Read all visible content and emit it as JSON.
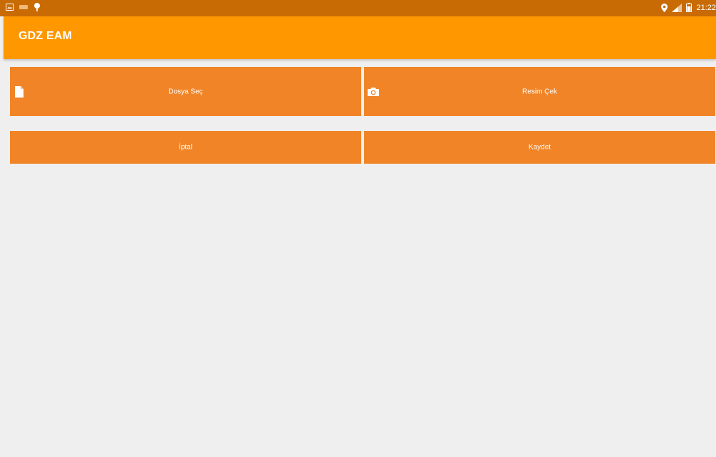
{
  "status_bar": {
    "time": "21:22",
    "left_icons": [
      "gallery-icon",
      "keyboard-icon",
      "pin-icon"
    ],
    "right_icons": [
      "location-icon",
      "signal-icon",
      "battery-icon"
    ]
  },
  "app_bar": {
    "title": "GDZ EAM"
  },
  "buttons": {
    "select_file": {
      "label": "Dosya Seç",
      "icon": "file-icon"
    },
    "take_photo": {
      "label": "Resim Çek",
      "icon": "camera-icon"
    },
    "cancel": {
      "label": "İptal"
    },
    "save": {
      "label": "Kaydet"
    }
  },
  "colors": {
    "status_bar": "#c96b05",
    "app_bar": "#ff9800",
    "button": "#f08427",
    "background": "#efefef"
  }
}
